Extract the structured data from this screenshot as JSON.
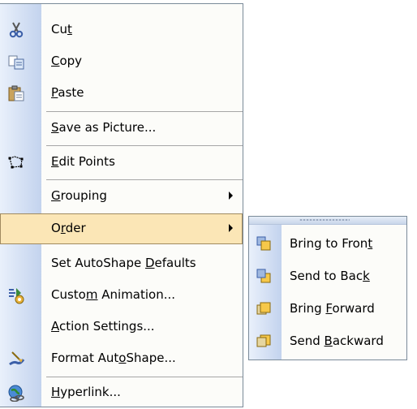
{
  "menu": {
    "items": [
      {
        "name": "cut",
        "label_pre": "Cu",
        "label_u": "t",
        "label_post": ""
      },
      {
        "name": "copy",
        "label_pre": "",
        "label_u": "C",
        "label_post": "opy"
      },
      {
        "name": "paste",
        "label_pre": "",
        "label_u": "P",
        "label_post": "aste"
      },
      {
        "name": "save-as-picture",
        "label_pre": "",
        "label_u": "S",
        "label_post": "ave as Picture..."
      },
      {
        "name": "edit-points",
        "label_pre": "",
        "label_u": "E",
        "label_post": "dit Points"
      },
      {
        "name": "grouping",
        "label_pre": "",
        "label_u": "G",
        "label_post": "rouping"
      },
      {
        "name": "order",
        "label_pre": "O",
        "label_u": "r",
        "label_post": "der"
      },
      {
        "name": "set-autoshape-defaults",
        "label_pre": "Set AutoShape ",
        "label_u": "D",
        "label_post": "efaults"
      },
      {
        "name": "custom-animation",
        "label_pre": "Custo",
        "label_u": "m",
        "label_post": " Animation..."
      },
      {
        "name": "action-settings",
        "label_pre": "",
        "label_u": "A",
        "label_post": "ction Settings..."
      },
      {
        "name": "format-autoshape",
        "label_pre": "Format Aut",
        "label_u": "o",
        "label_post": "Shape..."
      },
      {
        "name": "hyperlink",
        "label_pre": "",
        "label_u": "H",
        "label_post": "yperlink..."
      }
    ]
  },
  "submenu": {
    "items": [
      {
        "name": "bring-to-front",
        "label_pre": "Bring to Fron",
        "label_u": "t",
        "label_post": ""
      },
      {
        "name": "send-to-back",
        "label_pre": "Send to Bac",
        "label_u": "k",
        "label_post": ""
      },
      {
        "name": "bring-forward",
        "label_pre": "Bring ",
        "label_u": "F",
        "label_post": "orward"
      },
      {
        "name": "send-backward",
        "label_pre": "Send ",
        "label_u": "B",
        "label_post": "ackward"
      }
    ]
  },
  "icons": {
    "cut": "scissors-icon",
    "copy": "copy-icon",
    "paste": "paste-icon",
    "edit_points": "edit-points-icon",
    "custom_animation": "custom-animation-icon",
    "format_autoshape": "format-autoshape-icon",
    "hyperlink": "hyperlink-icon",
    "bring_to_front": "bring-to-front-icon",
    "send_to_back": "send-to-back-icon",
    "bring_forward": "bring-forward-icon",
    "send_backward": "send-backward-icon"
  },
  "colors": {
    "highlight_bg": "#fbe6b6",
    "highlight_border": "#a08a60",
    "gutter_light": "#e9f0fb",
    "gutter_dark": "#c3d3ee",
    "menu_border": "#7a8a99"
  }
}
